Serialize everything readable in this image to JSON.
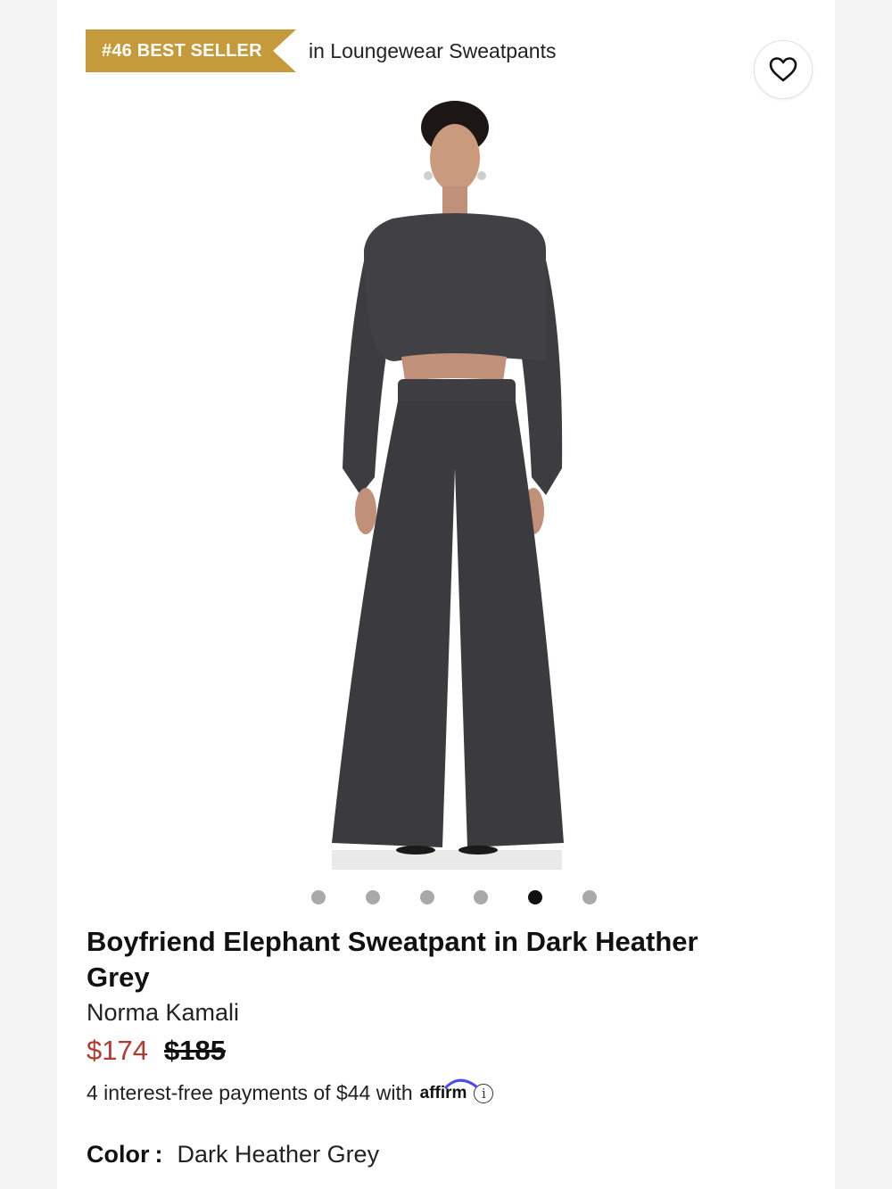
{
  "badge": {
    "label": "#46 BEST SELLER",
    "suffix": "in Loungewear Sweatpants",
    "color": "#c49a3b"
  },
  "favorite": {
    "icon": "heart-icon"
  },
  "image": {
    "alt_icon": "product-photo",
    "carousel": {
      "count": 6,
      "active_index": 4
    }
  },
  "product": {
    "title": "Boyfriend Elephant Sweatpant in Dark Heather Grey",
    "brand": "Norma Kamali",
    "sale_price": "$174",
    "original_price": "$185",
    "sale_color": "#b23a2e"
  },
  "financing": {
    "text": "4 interest-free payments of $44 with",
    "provider": "affirm",
    "info_icon": "info-icon"
  },
  "color": {
    "label": "Color",
    "separator": ":",
    "value": "Dark Heather Grey"
  }
}
